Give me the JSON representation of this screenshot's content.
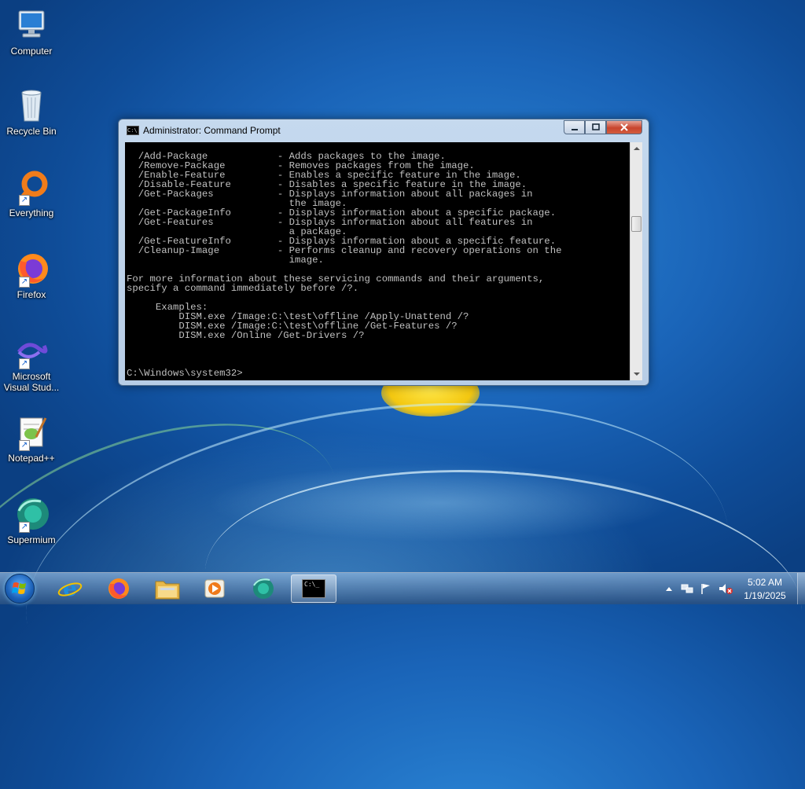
{
  "desktop": {
    "icons": [
      {
        "label": "Computer"
      },
      {
        "label": "Recycle Bin"
      },
      {
        "label": "Everything"
      },
      {
        "label": "Firefox"
      },
      {
        "label": "Microsoft Visual Stud..."
      },
      {
        "label": "Notepad++"
      },
      {
        "label": "Supermium"
      }
    ]
  },
  "window": {
    "title": "Administrator: Command Prompt",
    "console_text": "  /Add-Package            - Adds packages to the image.\n  /Remove-Package         - Removes packages from the image.\n  /Enable-Feature         - Enables a specific feature in the image.\n  /Disable-Feature        - Disables a specific feature in the image.\n  /Get-Packages           - Displays information about all packages in\n                            the image.\n  /Get-PackageInfo        - Displays information about a specific package.\n  /Get-Features           - Displays information about all features in\n                            a package.\n  /Get-FeatureInfo        - Displays information about a specific feature.\n  /Cleanup-Image          - Performs cleanup and recovery operations on the\n                            image.\n\nFor more information about these servicing commands and their arguments,\nspecify a command immediately before /?.\n\n     Examples:\n         DISM.exe /Image:C:\\test\\offline /Apply-Unattend /?\n         DISM.exe /Image:C:\\test\\offline /Get-Features /?\n         DISM.exe /Online /Get-Drivers /?\n\n\n\nC:\\Windows\\system32>",
    "title_icon_text": "C:\\"
  },
  "taskbar": {
    "items": [
      "start-orb",
      "internet-explorer-icon",
      "firefox-icon",
      "file-explorer-icon",
      "media-player-icon",
      "supermium-icon",
      "command-prompt-icon"
    ],
    "clock_time": "5:02 AM",
    "clock_date": "1/19/2025",
    "cmd_glyph": "C:\\_"
  },
  "colors": {
    "console_bg": "#000000",
    "console_fg": "#c0c0c0",
    "close_button": "#c8442d",
    "taskbar": "#2a5484"
  }
}
